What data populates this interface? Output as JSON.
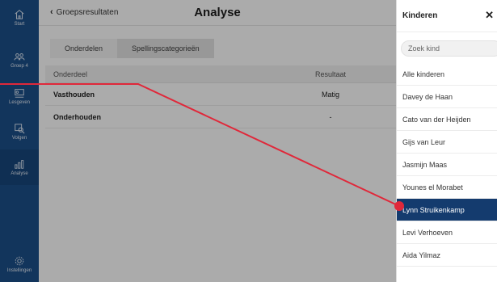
{
  "nav": {
    "items": [
      {
        "label": "Start",
        "icon": "home-icon"
      },
      {
        "label": "Groep 4",
        "icon": "group-icon"
      },
      {
        "label": "Lesgeven",
        "icon": "teach-icon"
      },
      {
        "label": "Volgen",
        "icon": "track-icon"
      },
      {
        "label": "Analyse",
        "icon": "chart-icon"
      },
      {
        "label": "Instellingen",
        "icon": "gear-icon"
      }
    ],
    "active": "Analyse"
  },
  "header": {
    "back_label": "Groepsresultaten",
    "title": "Analyse"
  },
  "tabs": [
    {
      "label": "Onderdelen"
    },
    {
      "label": "Spellingscategorieën"
    }
  ],
  "table": {
    "headers": [
      "Onderdeel",
      "Resultaat"
    ],
    "rows": [
      {
        "name": "Vasthouden",
        "result": "Matig"
      },
      {
        "name": "Onderhouden",
        "result": "-"
      }
    ]
  },
  "drawer": {
    "title": "Kinderen",
    "search_placeholder": "Zoek kind",
    "items": [
      "Alle kinderen",
      "Davey de Haan",
      "Cato van der Heijden",
      "Gijs van Leur",
      "Jasmijn Maas",
      "Younes el Morabet",
      "Lynn Struikenkamp",
      "Levi Verhoeven",
      "Aida Yilmaz"
    ],
    "selected": "Lynn Struikenkamp"
  },
  "colors": {
    "rail": "#1b4f8a",
    "selected": "#143b6e",
    "pointer": "#e0283a"
  }
}
